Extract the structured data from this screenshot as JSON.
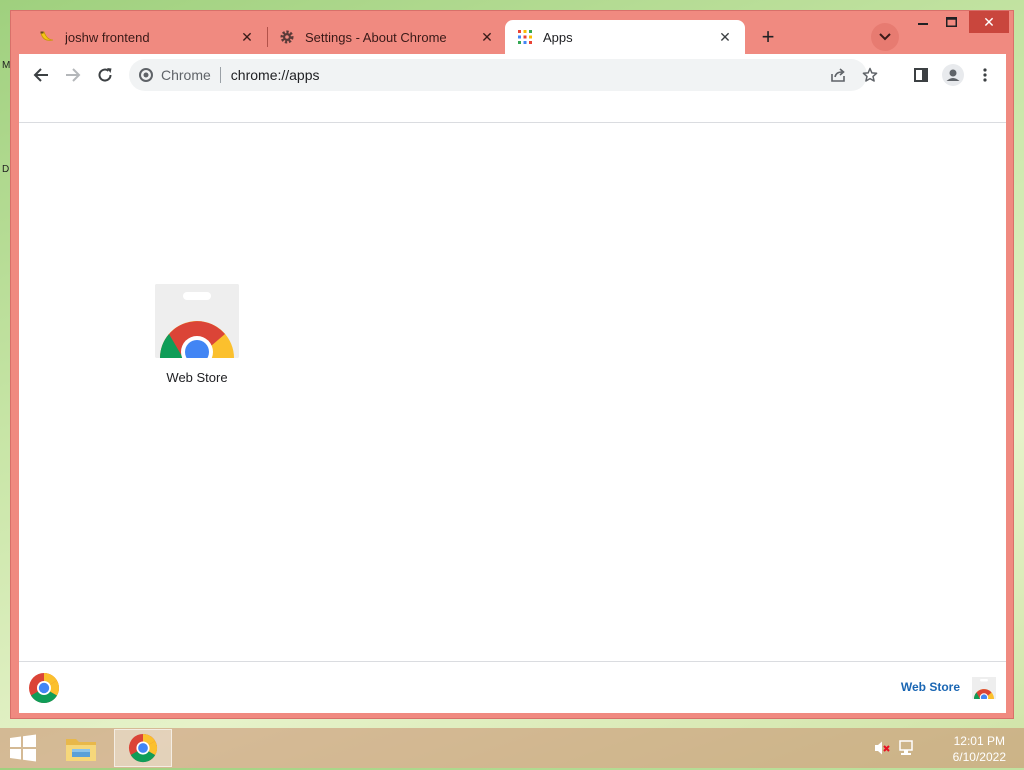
{
  "desktop": {
    "edge_letters": [
      "M",
      "D"
    ]
  },
  "tabs": [
    {
      "title": "joshw frontend",
      "icon": "banana-icon",
      "active": false
    },
    {
      "title": "Settings - About Chrome",
      "icon": "gear-icon",
      "active": false
    },
    {
      "title": "Apps",
      "icon": "apps-grid-icon",
      "active": true
    }
  ],
  "toolbar": {
    "site_chip": "Chrome",
    "url": "chrome://apps"
  },
  "apps": [
    {
      "label": "Web Store"
    }
  ],
  "footer": {
    "link": "Web Store"
  },
  "taskbar": {
    "time": "12:01 PM",
    "date": "6/10/2022"
  },
  "colors": {
    "frame": "#f08a80",
    "close_button": "#c9463d",
    "link": "#1a66b3"
  }
}
